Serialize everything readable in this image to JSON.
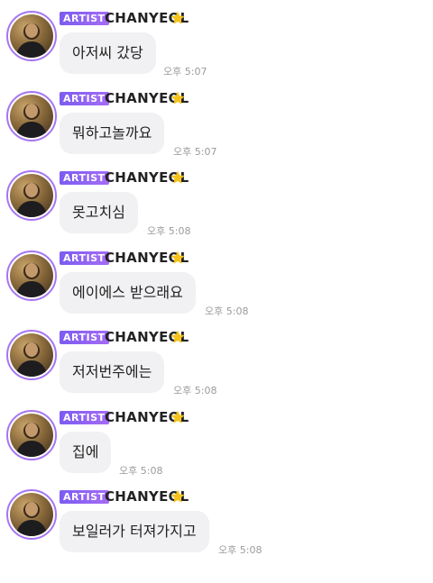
{
  "messages": [
    {
      "badge": "ARTIST",
      "name": "CHANYEOL",
      "text": "아저씨 갔당",
      "time": "오후 5:07"
    },
    {
      "badge": "ARTIST",
      "name": "CHANYEOL",
      "text": "뭐하고놀까요",
      "time": "오후 5:07"
    },
    {
      "badge": "ARTIST",
      "name": "CHANYEOL",
      "text": "못고치심",
      "time": "오후 5:08"
    },
    {
      "badge": "ARTIST",
      "name": "CHANYEOL",
      "text": "에이에스 받으래요",
      "time": "오후 5:08"
    },
    {
      "badge": "ARTIST",
      "name": "CHANYEOL",
      "text": "저저번주에는",
      "time": "오후 5:08"
    },
    {
      "badge": "ARTIST",
      "name": "CHANYEOL",
      "text": "집에",
      "time": "오후 5:08"
    },
    {
      "badge": "ARTIST",
      "name": "CHANYEOL",
      "text": "보일러가 터져가지고",
      "time": "오후 5:08"
    }
  ],
  "icons": {
    "avatar": "profile-photo",
    "star": "star-icon"
  },
  "colors": {
    "accent": "#8a62f3",
    "bubble": "#f1f1f3",
    "time": "#9b9b9b",
    "star": "#f4c21a"
  }
}
